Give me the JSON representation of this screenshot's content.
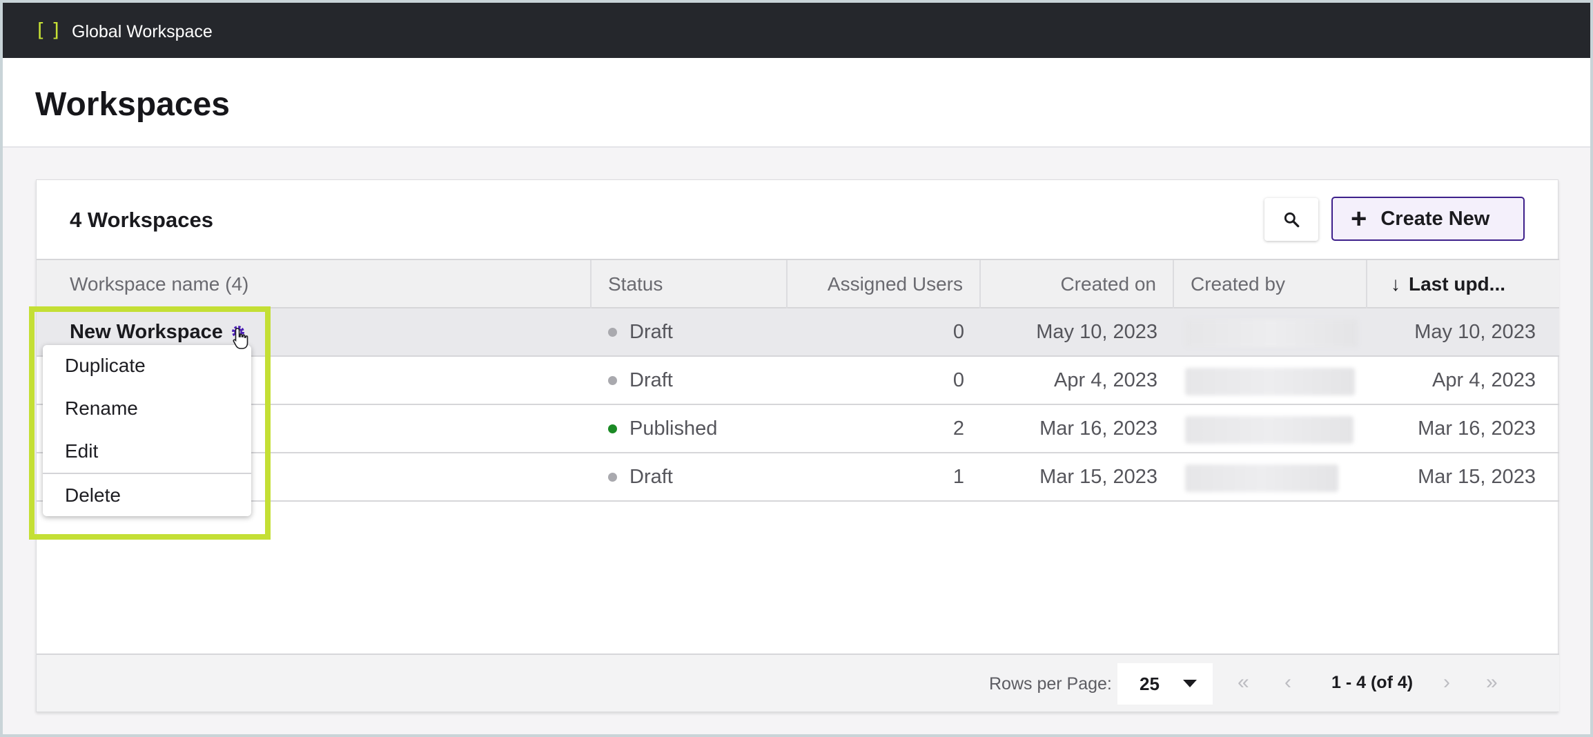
{
  "topbar": {
    "brand_icon": "[ ]",
    "title": "Global Workspace"
  },
  "header": {
    "title": "Workspaces"
  },
  "card": {
    "title": "4 Workspaces",
    "search_icon": "search-icon",
    "create_button": {
      "icon": "+",
      "label": "Create New"
    }
  },
  "table": {
    "columns": [
      "Workspace name (4)",
      "Status",
      "Assigned Users",
      "Created on",
      "Created by",
      "Last upd..."
    ],
    "sort_icon": "↓",
    "rows": [
      {
        "name": "New Workspace",
        "status": "Draft",
        "status_color": "#a9a9ae",
        "users": "0",
        "created_on": "May 10, 2023",
        "last_updated": "May 10, 2023"
      },
      {
        "name": "",
        "status": "Draft",
        "status_color": "#a9a9ae",
        "users": "0",
        "created_on": "Apr 4, 2023",
        "last_updated": "Apr 4, 2023"
      },
      {
        "name": "",
        "status": "Published",
        "status_color": "#1b8a25",
        "users": "2",
        "created_on": "Mar 16, 2023",
        "last_updated": "Mar 16, 2023"
      },
      {
        "name": "",
        "status": "Draft",
        "status_color": "#a9a9ae",
        "users": "1",
        "created_on": "Mar 15, 2023",
        "last_updated": "Mar 15, 2023"
      }
    ]
  },
  "context_menu": {
    "items": [
      "Duplicate",
      "Rename",
      "Edit",
      "Delete"
    ]
  },
  "pagination": {
    "rows_per_page_label": "Rows per Page:",
    "rows_per_page_value": "25",
    "range": "1 - 4 (of 4)",
    "first": "«",
    "prev": "‹",
    "next": "›",
    "last": "»"
  },
  "colors": {
    "accent": "#3d1f8a",
    "highlight": "#c4df35",
    "topbar": "#25272c",
    "gear": "#4b1fb3"
  }
}
